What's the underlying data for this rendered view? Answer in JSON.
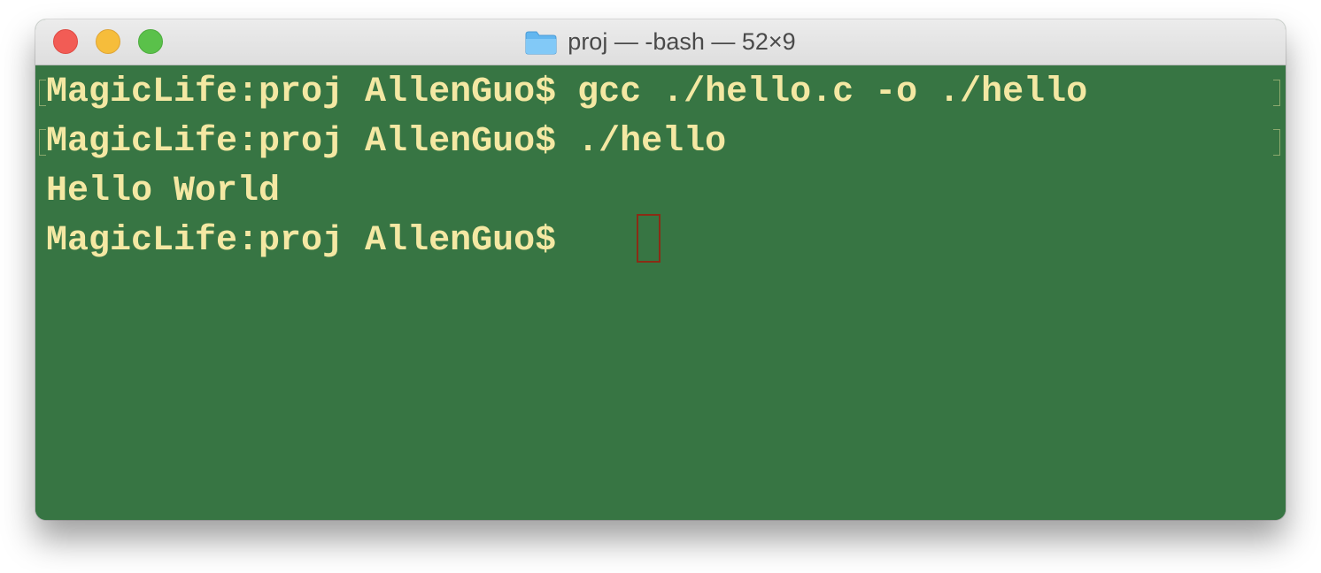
{
  "window": {
    "title": "proj — -bash — 52×9",
    "title_icon": "folder-icon",
    "controls": [
      "close",
      "minimize",
      "zoom"
    ]
  },
  "terminal": {
    "lines": [
      "MagicLife:proj AllenGuo$ gcc ./hello.c -o ./hello",
      "MagicLife:proj AllenGuo$ ./hello",
      "Hello World",
      "MagicLife:proj AllenGuo$ "
    ],
    "cursor": "block-cursor"
  },
  "colors": {
    "background": "#377543",
    "text": "#f4e8a3",
    "cursor": "#8a2c15",
    "close": "#f25c55",
    "minimize": "#f6bd3b",
    "zoom": "#5ac14a"
  }
}
